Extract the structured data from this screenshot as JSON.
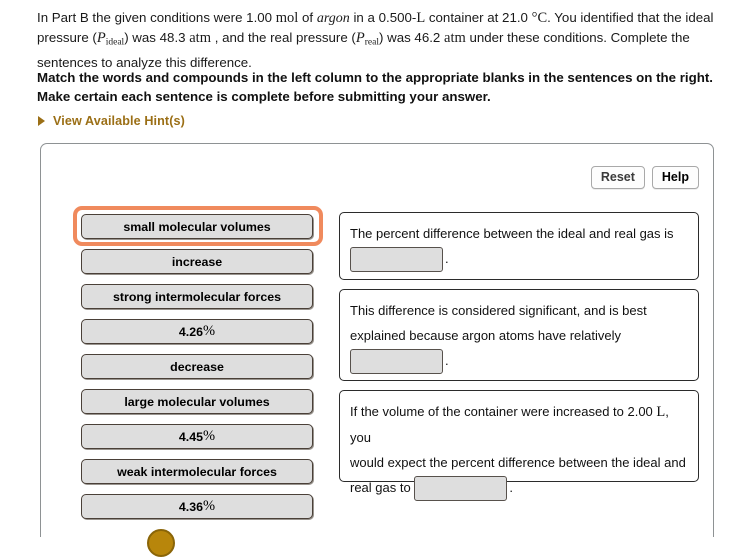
{
  "prompt": {
    "part1": "In Part B the given conditions were 1.00",
    "unit_mol": "mol",
    "part2": "of",
    "species": "argon",
    "part3": "in a 0.500-",
    "unit_l": "L",
    "part4": "container at 21.0",
    "temp_unit": "°C",
    "part5": ". You identified that the ideal pressure (",
    "p_symbol": "P",
    "p_ideal_sub": "ideal",
    "part6": ") was 48.3",
    "unit_atm": "atm",
    "part7": ", and the real pressure (",
    "p_real_sub": "real",
    "part8": ") was 46.2",
    "unit_atm2": "atm",
    "part9": "under these conditions. Complete the sentences to analyze this difference."
  },
  "instructions": {
    "text": "Match the words and compounds in the left column to the appropriate blanks in the sentences on the right. Make certain each sentence is complete before submitting your answer."
  },
  "hint": {
    "label": "View Available Hint(s)",
    "color": "#9b6f16"
  },
  "toolbar": {
    "reset_label": "Reset",
    "help_label": "Help"
  },
  "bank": {
    "selected_index": 0,
    "highlight_color": "#f08a5d",
    "tile_fill": "#dedede",
    "items": [
      {
        "label": "small molecular volumes",
        "is_percent": false
      },
      {
        "label": "increase",
        "is_percent": false
      },
      {
        "label": "strong intermolecular forces",
        "is_percent": false
      },
      {
        "label": "4.26",
        "is_percent": true,
        "suffix": "%"
      },
      {
        "label": "decrease",
        "is_percent": false
      },
      {
        "label": "large molecular volumes",
        "is_percent": false
      },
      {
        "label": "4.45",
        "is_percent": true,
        "suffix": "%"
      },
      {
        "label": "weak intermolecular forces",
        "is_percent": false
      },
      {
        "label": "4.36",
        "is_percent": true,
        "suffix": "%"
      }
    ]
  },
  "cards": [
    {
      "line1": "The percent difference between the ideal and real gas is",
      "after_blank": "."
    },
    {
      "line1": "This difference is considered significant, and is best",
      "line2": "explained because argon atoms have relatively",
      "after_blank": "."
    },
    {
      "line1_a": "If the volume of the container were increased to 2.00",
      "line1_unit": "L",
      "line1_b": ", you",
      "line2": "would expect the percent difference between the ideal and",
      "line3_before": "real gas to",
      "after_blank": "."
    }
  ]
}
